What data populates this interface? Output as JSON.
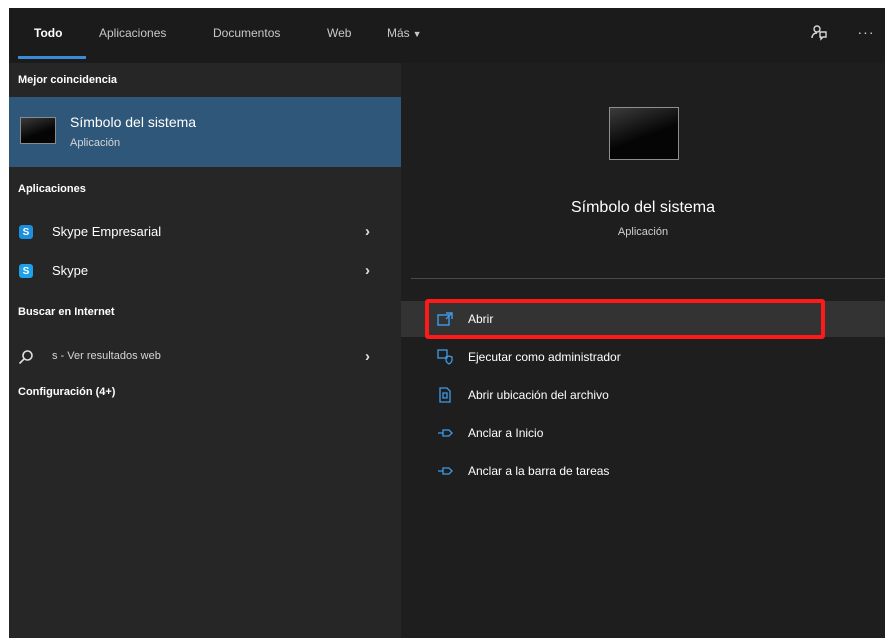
{
  "tabs": [
    {
      "label": "Todo",
      "active": true
    },
    {
      "label": "Aplicaciones",
      "active": false
    },
    {
      "label": "Documentos",
      "active": false
    },
    {
      "label": "Web",
      "active": false
    },
    {
      "label": "Más",
      "active": false
    }
  ],
  "top_icons": [
    "feedback-icon",
    "more-options-icon"
  ],
  "left": {
    "best_match_header": "Mejor coincidencia",
    "best_match": {
      "title": "Símbolo del sistema",
      "subtitle": "Aplicación"
    },
    "apps_header": "Aplicaciones",
    "apps": [
      {
        "label": "Skype Empresarial",
        "icon": "skype-business-icon"
      },
      {
        "label": "Skype",
        "icon": "skype-icon"
      }
    ],
    "web_header": "Buscar en Internet",
    "web_result": {
      "label": "s - Ver resultados web",
      "icon": "search-icon"
    },
    "settings_header": "Configuración (4+)"
  },
  "preview": {
    "title": "Símbolo del sistema",
    "subtitle": "Aplicación",
    "actions": [
      {
        "label": "Abrir",
        "icon": "open-icon",
        "highlighted": true
      },
      {
        "label": "Ejecutar como administrador",
        "icon": "run-as-admin-icon"
      },
      {
        "label": "Abrir ubicación del archivo",
        "icon": "file-location-icon"
      },
      {
        "label": "Anclar a Inicio",
        "icon": "pin-icon"
      },
      {
        "label": "Anclar a la barra de tareas",
        "icon": "pin-taskbar-icon"
      }
    ]
  },
  "colors": {
    "accent": "#3a8ad6",
    "selection": "#2f5779",
    "highlight_box": "#ff1a1a"
  }
}
